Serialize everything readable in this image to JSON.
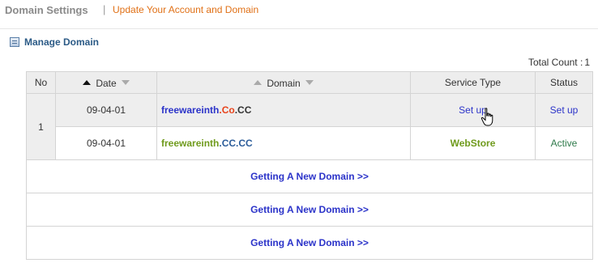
{
  "header": {
    "title": "Domain Settings",
    "separator": "|",
    "subtitle": "Update Your Account and Domain"
  },
  "section": {
    "label": "Manage Domain"
  },
  "total": {
    "label": "Total Count :",
    "value": "1"
  },
  "table": {
    "headers": {
      "no": "No",
      "date": "Date",
      "domain": "Domain",
      "service_type": "Service Type",
      "status": "Status"
    },
    "group_no": "1",
    "rows": [
      {
        "date": "09-04-01",
        "domain_parts": [
          "freewareinth",
          ".Co",
          ".CC"
        ],
        "service_type": "Set up",
        "status": "Set up"
      },
      {
        "date": "09-04-01",
        "domain_parts": [
          "freewareinth",
          ".CC",
          ".CC"
        ],
        "service_type": "WebStore",
        "status": "Active"
      }
    ],
    "new_domain_links": [
      "Getting A New Domain >>",
      "Getting A New Domain >>",
      "Getting A New Domain >>"
    ]
  },
  "colors": {
    "accent_orange": "#e07016",
    "link_blue": "#2b33c9",
    "domain_red": "#e8421a",
    "domain_green": "#6f9a1c",
    "status_green": "#2e7a4a"
  },
  "icons": {
    "section_icon": "list-box-icon",
    "sort_up": "arrow-up-icon",
    "sort_down": "arrow-down-icon",
    "cursor": "hand-pointer-icon"
  }
}
